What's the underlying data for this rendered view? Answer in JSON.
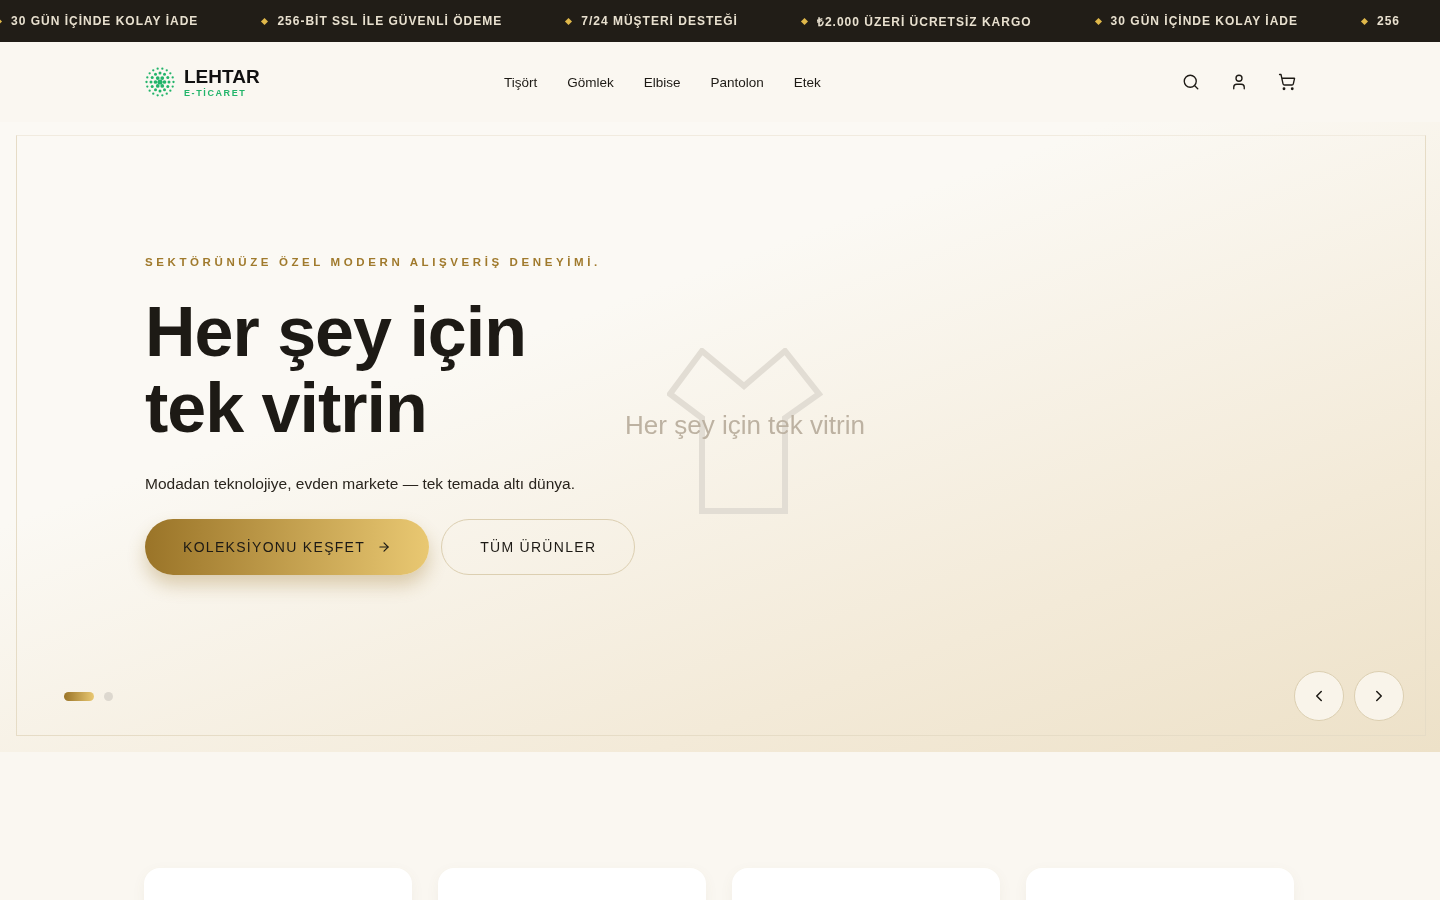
{
  "ticker": [
    "30 GÜN İÇİNDE KOLAY İADE",
    "256-BİT SSL İLE GÜVENLİ ÖDEME",
    "7/24 MÜŞTERİ DESTEĞİ",
    "₺2.000 ÜZERİ ÜCRETSİZ KARGO",
    "30 GÜN İÇİNDE KOLAY İADE",
    "256"
  ],
  "logo": {
    "name": "LEHTAR",
    "tagline": "E-TİCARET"
  },
  "nav": [
    "Tişört",
    "Gömlek",
    "Elbise",
    "Pantolon",
    "Etek"
  ],
  "hero": {
    "eyebrow": "SEKTÖRÜNÜZE ÖZEL MODERN ALIŞVERİŞ DENEYİMİ.",
    "title": [
      "Her şey için",
      "tek vitrin"
    ],
    "text": "Modadan teknolojiye, evden markete — tek temada altı dünya.",
    "buttons": [
      {
        "label": "KOLEKSİYONU KEŞFET",
        "kind": "primary"
      },
      {
        "label": "TÜM ÜRÜNLER",
        "kind": "outline"
      }
    ],
    "image_caption": "Her şey için tek vitrin",
    "slides": [
      {
        "selected": true
      },
      {
        "selected": false
      }
    ]
  }
}
